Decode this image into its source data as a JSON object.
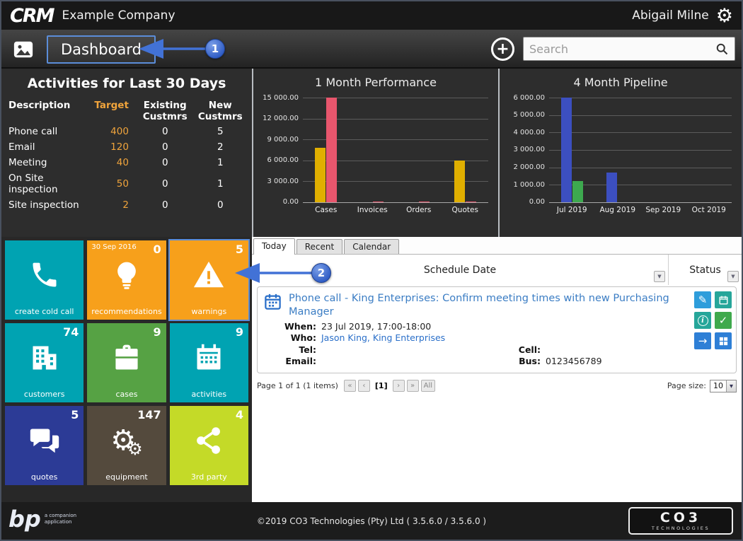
{
  "topbar": {
    "logo": "CRM",
    "company": "Example Company",
    "user": "Abigail Milne"
  },
  "navbar": {
    "page_title": "Dashboard",
    "search_placeholder": "Search"
  },
  "annotations": {
    "step1": "1",
    "step2": "2"
  },
  "icons": {
    "gear": "⚙",
    "pencil": "✎",
    "check": "✓",
    "arrow": "→",
    "plus": "+",
    "caret": "▼",
    "info": "i"
  },
  "activities_panel": {
    "title": "Activities for Last 30 Days",
    "columns": [
      "Description",
      "Target",
      "Existing Custmrs",
      "New Custmrs"
    ],
    "rows": [
      {
        "description": "Phone call",
        "target": "400",
        "existing": "0",
        "new": "5"
      },
      {
        "description": "Email",
        "target": "120",
        "existing": "0",
        "new": "2"
      },
      {
        "description": "Meeting",
        "target": "40",
        "existing": "0",
        "new": "1"
      },
      {
        "description": "On Site inspection",
        "target": "50",
        "existing": "0",
        "new": "1"
      },
      {
        "description": "Site inspection",
        "target": "2",
        "existing": "0",
        "new": "0"
      }
    ]
  },
  "chart_data": [
    {
      "type": "bar",
      "title": "1 Month Performance",
      "categories": [
        "Cases",
        "Invoices",
        "Orders",
        "Quotes"
      ],
      "series": [
        {
          "name": "series1",
          "color": "#e0af00",
          "values": [
            7800,
            0,
            0,
            6000
          ]
        },
        {
          "name": "series2",
          "color": "#e8566d",
          "values": [
            15000,
            150,
            150,
            150
          ]
        }
      ],
      "ylim": [
        0,
        15000
      ],
      "yticks": [
        "15 000.00",
        "12 000.00",
        "9 000.00",
        "6 000.00",
        "3 000.00",
        "0.00"
      ],
      "grid": true,
      "legend": "none"
    },
    {
      "type": "bar",
      "title": "4 Month Pipeline",
      "categories": [
        "Jul 2019",
        "Aug 2019",
        "Sep 2019",
        "Oct 2019"
      ],
      "series": [
        {
          "name": "series1",
          "color": "#3c4fc0",
          "values": [
            6000,
            1700,
            0,
            0
          ]
        },
        {
          "name": "series2",
          "color": "#3da94f",
          "values": [
            1200,
            0,
            0,
            0
          ]
        }
      ],
      "ylim": [
        0,
        6000
      ],
      "yticks": [
        "6 000.00",
        "5 000.00",
        "4 000.00",
        "3 000.00",
        "2 000.00",
        "1 000.00",
        "0.00"
      ],
      "grid": true,
      "legend": "none"
    }
  ],
  "tiles": [
    {
      "label": "create cold call",
      "count": "",
      "date": "",
      "color": "#00a3b2",
      "icon": "phone",
      "highlighted": false
    },
    {
      "label": "recommendations",
      "count": "0",
      "date": "30 Sep 2016",
      "color": "#f7a01b",
      "icon": "lightbulb",
      "highlighted": false
    },
    {
      "label": "warnings",
      "count": "5",
      "date": "",
      "color": "#f7a01b",
      "icon": "warning",
      "highlighted": true
    },
    {
      "label": "customers",
      "count": "74",
      "date": "",
      "color": "#00a3b2",
      "icon": "building",
      "highlighted": false
    },
    {
      "label": "cases",
      "count": "9",
      "date": "",
      "color": "#56a244",
      "icon": "briefcase",
      "highlighted": false
    },
    {
      "label": "activities",
      "count": "9",
      "date": "",
      "color": "#00a3b2",
      "icon": "calendar",
      "highlighted": false
    },
    {
      "label": "quotes",
      "count": "5",
      "date": "",
      "color": "#2c3b96",
      "icon": "chat",
      "highlighted": false
    },
    {
      "label": "equipment",
      "count": "147",
      "date": "",
      "color": "#544a3d",
      "icon": "gears",
      "highlighted": false
    },
    {
      "label": "3rd party",
      "count": "4",
      "date": "",
      "color": "#c4da28",
      "icon": "share",
      "highlighted": false
    }
  ],
  "schedule": {
    "tabs": [
      "Today",
      "Recent",
      "Calendar"
    ],
    "active_tab": "Today",
    "columns": {
      "schedule_date": "Schedule Date",
      "status": "Status"
    },
    "item": {
      "title": "Phone call - King Enterprises: Confirm meeting times with new Purchasing Manager",
      "when_label": "When:",
      "when": "23 Jul 2019, 17:00-18:00",
      "who_label": "Who:",
      "who": "Jason King, King Enterprises",
      "tel_label": "Tel:",
      "tel": "",
      "email_label": "Email:",
      "email": "",
      "cell_label": "Cell:",
      "cell": "",
      "bus_label": "Bus:",
      "bus": "0123456789"
    },
    "pagination": {
      "summary": "Page 1 of 1 (1 items)",
      "buttons": [
        "«",
        "‹",
        "[1]",
        "›",
        "»",
        "All"
      ],
      "current_page": "[1]",
      "page_size_label": "Page size:",
      "page_size": "10"
    }
  },
  "footer": {
    "copyright": "©2019 CO3 Technologies (Pty) Ltd ( 3.5.6.0 / 3.5.6.0 )",
    "bp_logo": "bp",
    "bp_sub": "a companion application",
    "co3_logo": "CO3",
    "co3_sub": "TECHNOLOGIES"
  }
}
